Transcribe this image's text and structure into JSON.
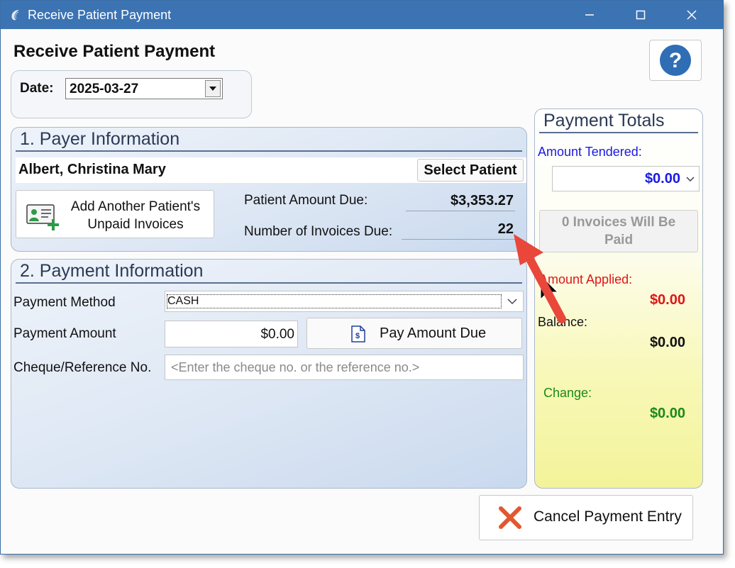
{
  "window": {
    "title": "Receive Patient Payment",
    "heading": "Receive Patient Payment",
    "controls": [
      "minimize",
      "maximize",
      "close"
    ]
  },
  "date": {
    "label": "Date:",
    "value": "2025-03-27"
  },
  "payer": {
    "section_title": "1. Payer Information",
    "patient_name": "Albert, Christina Mary",
    "select_patient_label": "Select Patient",
    "add_invoices_line1": "Add Another Patient's",
    "add_invoices_line2": "Unpaid Invoices",
    "amount_due_label": "Patient Amount Due:",
    "amount_due_value": "$3,353.27",
    "invoices_due_label": "Number of Invoices Due:",
    "invoices_due_value": "22"
  },
  "payment": {
    "section_title": "2. Payment Information",
    "method_label": "Payment Method",
    "method_value": "CASH",
    "amount_label": "Payment Amount",
    "amount_value": "$0.00",
    "pay_due_label": "Pay Amount Due",
    "reference_label": "Cheque/Reference No.",
    "reference_placeholder": "<Enter the cheque no. or the reference no.>"
  },
  "totals": {
    "title": "Payment Totals",
    "tendered_label": "Amount Tendered:",
    "tendered_value": "$0.00",
    "invoices_paid_line1": "0 Invoices Will Be",
    "invoices_paid_line2": "Paid",
    "applied_label": "Amount Applied:",
    "applied_value": "$0.00",
    "balance_label": "Balance:",
    "balance_value": "$0.00",
    "change_label": "Change:",
    "change_value": "$0.00"
  },
  "cancel_label": "Cancel Payment Entry",
  "colors": {
    "titlebar": "#3b73b3",
    "tendered": "#1a1ae6",
    "applied": "#e01414",
    "change": "#1a8a1a",
    "annotation_arrow": "#e8473a"
  },
  "icons": [
    "app-icon",
    "help-icon",
    "add-patient-card-icon",
    "invoice-dollar-icon",
    "cancel-x-icon",
    "chevron-down-icon"
  ]
}
